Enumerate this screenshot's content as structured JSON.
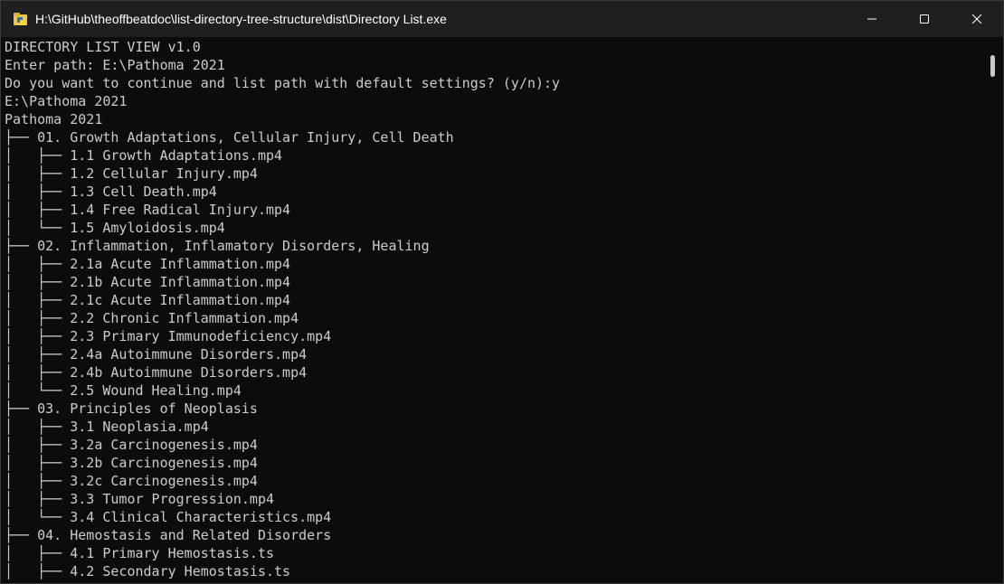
{
  "window": {
    "title": "H:\\GitHub\\theoffbeatdoc\\list-directory-tree-structure\\dist\\Directory List.exe",
    "app_icon": "python-folder-icon",
    "controls": [
      "minimize-icon",
      "maximize-icon",
      "close-icon"
    ]
  },
  "console": {
    "lines": [
      "DIRECTORY LIST VIEW v1.0",
      "Enter path: E:\\Pathoma 2021",
      "Do you want to continue and list path with default settings? (y/n):y",
      "E:\\Pathoma 2021",
      "Pathoma 2021",
      "├── 01. Growth Adaptations, Cellular Injury, Cell Death",
      "│   ├── 1.1 Growth Adaptations.mp4",
      "│   ├── 1.2 Cellular Injury.mp4",
      "│   ├── 1.3 Cell Death.mp4",
      "│   ├── 1.4 Free Radical Injury.mp4",
      "│   └── 1.5 Amyloidosis.mp4",
      "├── 02. Inflammation, Inflamatory Disorders, Healing",
      "│   ├── 2.1a Acute Inflammation.mp4",
      "│   ├── 2.1b Acute Inflammation.mp4",
      "│   ├── 2.1c Acute Inflammation.mp4",
      "│   ├── 2.2 Chronic Inflammation.mp4",
      "│   ├── 2.3 Primary Immunodeficiency.mp4",
      "│   ├── 2.4a Autoimmune Disorders.mp4",
      "│   ├── 2.4b Autoimmune Disorders.mp4",
      "│   └── 2.5 Wound Healing.mp4",
      "├── 03. Principles of Neoplasis",
      "│   ├── 3.1 Neoplasia.mp4",
      "│   ├── 3.2a Carcinogenesis.mp4",
      "│   ├── 3.2b Carcinogenesis.mp4",
      "│   ├── 3.2c Carcinogenesis.mp4",
      "│   ├── 3.3 Tumor Progression.mp4",
      "│   └── 3.4 Clinical Characteristics.mp4",
      "├── 04. Hemostasis and Related Disorders",
      "│   ├── 4.1 Primary Hemostasis.ts",
      "│   ├── 4.2 Secondary Hemostasis.ts"
    ]
  },
  "colors": {
    "background": "#0c0c0c",
    "titlebar": "#1f1f1f",
    "text": "#cccccc",
    "title_text": "#ffffff"
  }
}
